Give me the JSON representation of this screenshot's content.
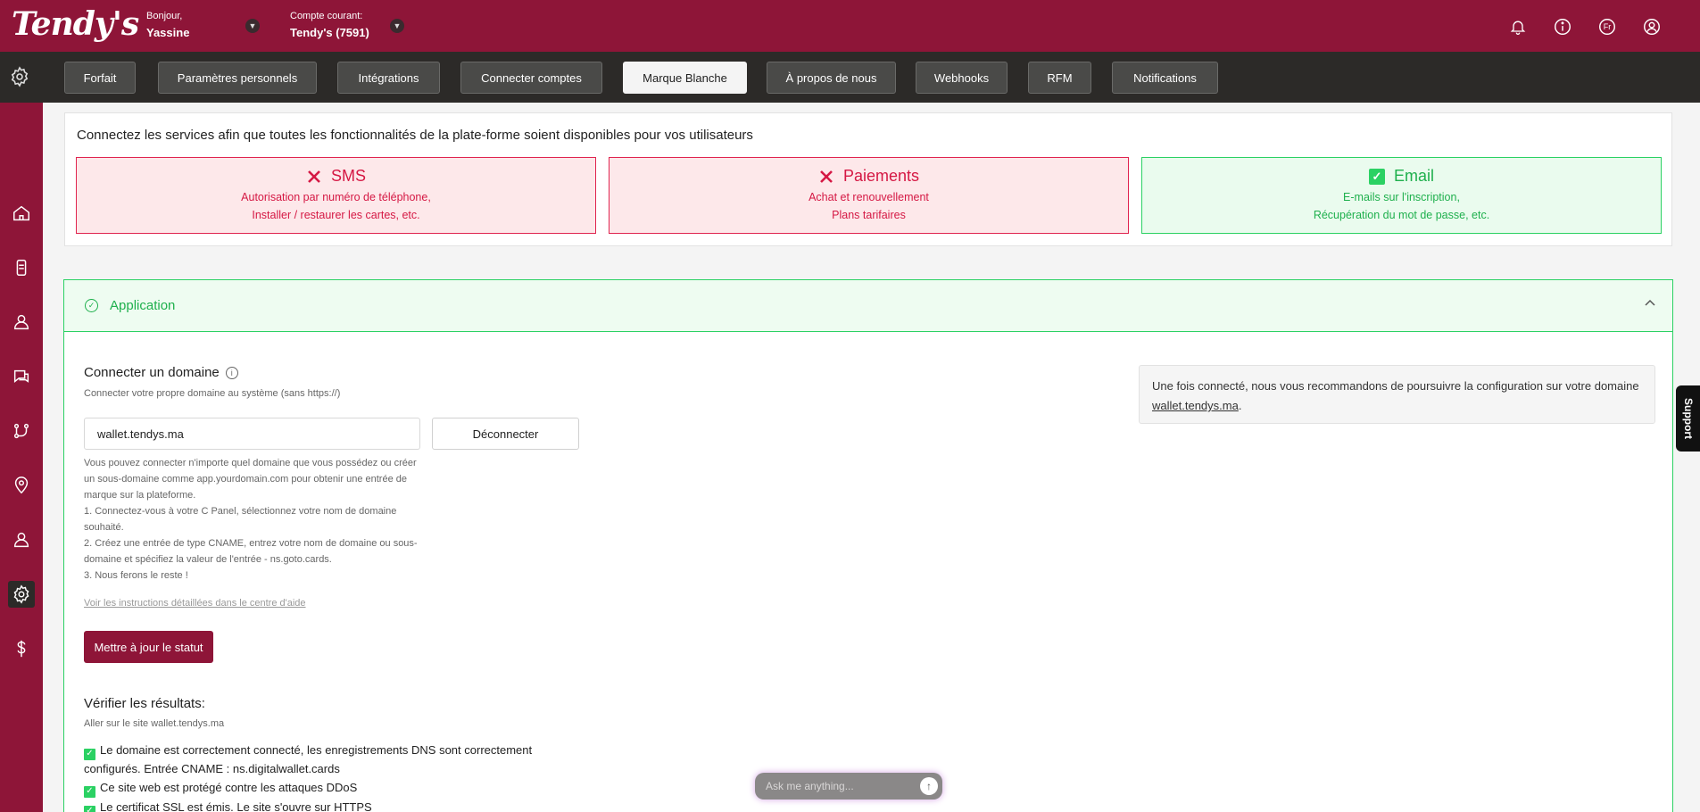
{
  "header": {
    "logo": "Tendy's",
    "greeting_small": "Bonjour,",
    "greeting_name": "Yassine",
    "account_small": "Compte courant:",
    "account_name": "Tendy's (7591)",
    "icons": [
      "bell-icon",
      "info-icon",
      "language-icon",
      "user-icon"
    ],
    "language": "Fr"
  },
  "tabs": [
    {
      "label": "Forfait"
    },
    {
      "label": "Paramètres personnels"
    },
    {
      "label": "Intégrations"
    },
    {
      "label": "Connecter comptes"
    },
    {
      "label": "Marque Blanche",
      "active": true
    },
    {
      "label": "À propos de nous"
    },
    {
      "label": "Webhooks"
    },
    {
      "label": "RFM"
    },
    {
      "label": "Notifications"
    }
  ],
  "sidebar": {
    "items": [
      "home-icon",
      "mobile-card-icon",
      "customers-icon",
      "chat-icon",
      "flow-icon",
      "location-icon",
      "user-icon",
      "settings-icon",
      "billing-icon"
    ],
    "active": "settings-icon"
  },
  "services": {
    "title": "Connectez les services afin que toutes les fonctionnalités de la plate-forme soient disponibles pour vos utilisateurs",
    "cards": [
      {
        "name": "SMS",
        "status": "error",
        "line1": "Autorisation par numéro de téléphone,",
        "line2": "Installer / restaurer les cartes, etc."
      },
      {
        "name": "Paiements",
        "status": "error",
        "line1": "Achat et renouvellement",
        "line2": "Plans tarifaires"
      },
      {
        "name": "Email",
        "status": "ok",
        "line1": "E-mails sur l'inscription,",
        "line2": "Récupération du mot de passe, etc."
      }
    ]
  },
  "application": {
    "title": "Application",
    "domain_title": "Connecter un domaine",
    "domain_subtitle": "Connecter votre propre domaine au système (sans https://)",
    "domain_value": "wallet.tendys.ma",
    "disconnect_label": "Déconnecter",
    "instructions": [
      "Vous pouvez connecter n'importe quel domaine que vous possédez ou créer un sous-domaine comme app.yourdomain.com pour obtenir une entrée de marque sur la plateforme.",
      "1. Connectez-vous à votre C Panel, sélectionnez votre nom de domaine souhaité.",
      "2. Créez une entrée de type CNAME, entrez votre nom de domaine ou sous-domaine et spécifiez la valeur de l'entrée - ns.goto.cards.",
      "3. Nous ferons le reste !"
    ],
    "help_link": "Voir les instructions détaillées dans le centre d'aide",
    "update_label": "Mettre à jour le statut",
    "verify_title": "Vérifier les résultats:",
    "verify_subtitle": "Aller sur le site wallet.tendys.ma",
    "checks": [
      "Le domaine est correctement connecté, les enregistrements DNS sont correctement configurés. Entrée CNAME : ns.digitalwallet.cards",
      "Ce site web est protégé contre les attaques DDoS",
      "Le certificat SSL est émis. Le site s'ouvre sur HTTPS"
    ],
    "note_prefix": "Une fois connecté, nous vous recommandons de poursuivre la configuration sur votre domaine ",
    "note_link": "wallet.tendys.ma",
    "note_suffix": "."
  },
  "support_label": "Support",
  "ask": {
    "placeholder": "Ask me anything..."
  },
  "colors": {
    "brand": "#8e1538",
    "dark": "#2c2a28",
    "error": "#d51844",
    "success": "#1fb04d"
  }
}
